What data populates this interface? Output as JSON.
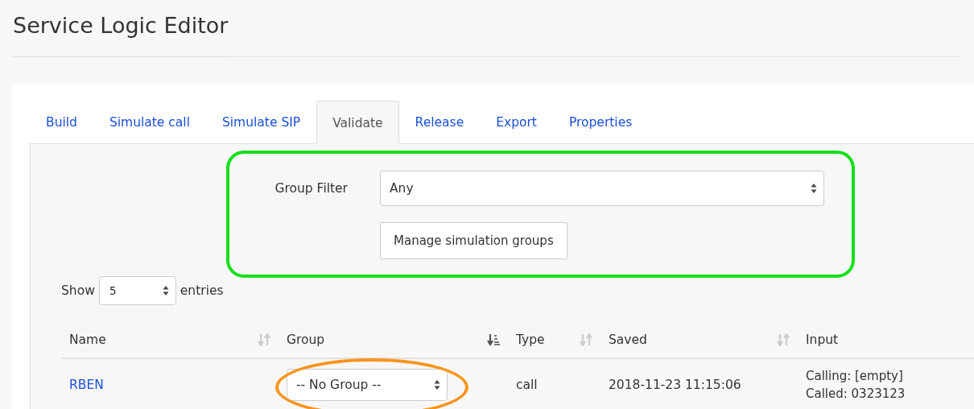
{
  "page": {
    "title": "Service Logic Editor"
  },
  "tabs": [
    {
      "label": "Build",
      "selected": false
    },
    {
      "label": "Simulate call",
      "selected": false
    },
    {
      "label": "Simulate SIP",
      "selected": false
    },
    {
      "label": "Validate",
      "selected": true
    },
    {
      "label": "Release",
      "selected": false
    },
    {
      "label": "Export",
      "selected": false
    },
    {
      "label": "Properties",
      "selected": false
    }
  ],
  "group_filter": {
    "label": "Group Filter",
    "value": "Any",
    "button": "Manage simulation groups"
  },
  "length": {
    "prefix": "Show",
    "value": "5",
    "suffix": "entries"
  },
  "table": {
    "columns": [
      {
        "label": "Name",
        "sorted": false
      },
      {
        "label": "Group",
        "sorted": true
      },
      {
        "label": "Type",
        "sorted": false
      },
      {
        "label": "Saved",
        "sorted": false
      },
      {
        "label": "Input"
      }
    ],
    "rows": [
      {
        "name": "RBEN",
        "group": "-- No Group --",
        "type": "call",
        "saved": "2018-11-23 11:15:06",
        "input": [
          "Calling: [empty]",
          "Called: 0323123"
        ]
      }
    ]
  }
}
